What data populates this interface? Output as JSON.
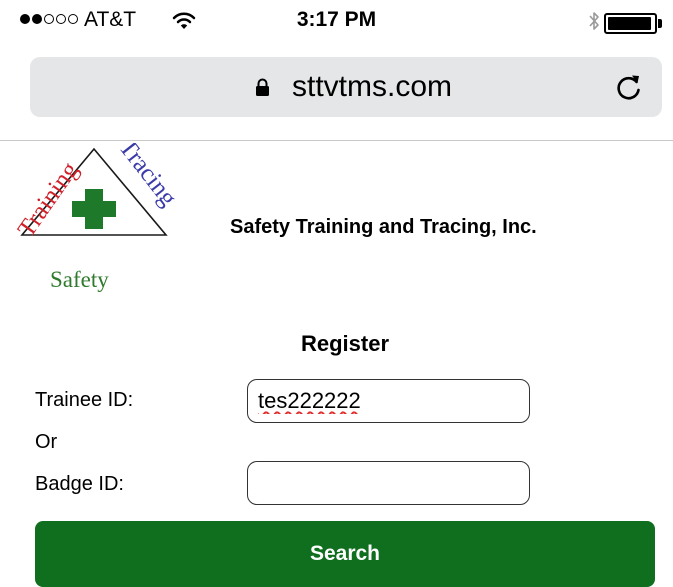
{
  "status_bar": {
    "signal_bars_filled": 2,
    "signal_bars_total": 5,
    "carrier": "AT&T",
    "time": "3:17 PM",
    "battery_level": 0.95
  },
  "browser": {
    "url": "sttvtms.com",
    "lock_icon": "lock-icon",
    "reload_icon": "reload-icon",
    "bar_color": "#e5e6e8"
  },
  "header": {
    "logo_words": {
      "left": "Training",
      "right": "Tracing",
      "bottom": "Safety"
    },
    "company_name": "Safety Training and Tracing, Inc."
  },
  "form": {
    "title": "Register",
    "trainee_label": "Trainee ID:",
    "trainee_value": "tes222222",
    "or_label": "Or",
    "badge_label": "Badge ID:",
    "badge_value": "",
    "search_label": "Search"
  },
  "colors": {
    "button_green": "#0f6f1f",
    "logo_red": "#d0202a",
    "logo_blue": "#3a3aa8",
    "logo_green": "#2f7a2c"
  }
}
